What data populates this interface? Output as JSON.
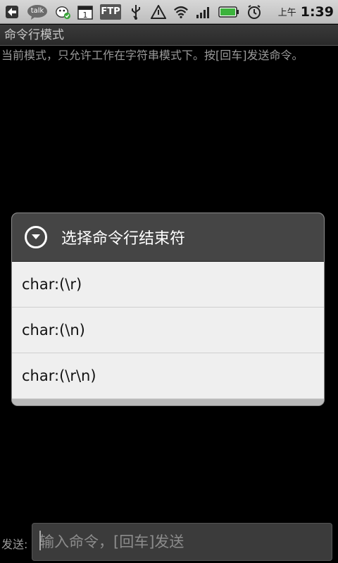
{
  "status_bar": {
    "icons": [
      "back-arrow-icon",
      "talk-icon",
      "cow-check-icon",
      "calendar-icon",
      "ftp-icon",
      "usb-icon",
      "warning-triangle-icon",
      "wifi-icon",
      "signal-bars-icon",
      "battery-icon",
      "alarm-clock-icon"
    ],
    "talk_label": "talk",
    "calendar_day": "1",
    "ftp_label": "FTP",
    "ampm": "上午",
    "time": "1:39"
  },
  "title": "命令行模式",
  "info_text": "当前模式，只允许工作在字符串模式下。按[回车]发送命令。",
  "dialog": {
    "title": "选择命令行结束符",
    "options": [
      "char:(\\r)",
      "char:(\\n)",
      "char:(\\r\\n)"
    ]
  },
  "input": {
    "label": "发送:",
    "placeholder": "输入命令，[回车]发送"
  },
  "colors": {
    "background": "#000000",
    "dialog_header": "#454545",
    "dialog_body": "#eeeeee"
  }
}
